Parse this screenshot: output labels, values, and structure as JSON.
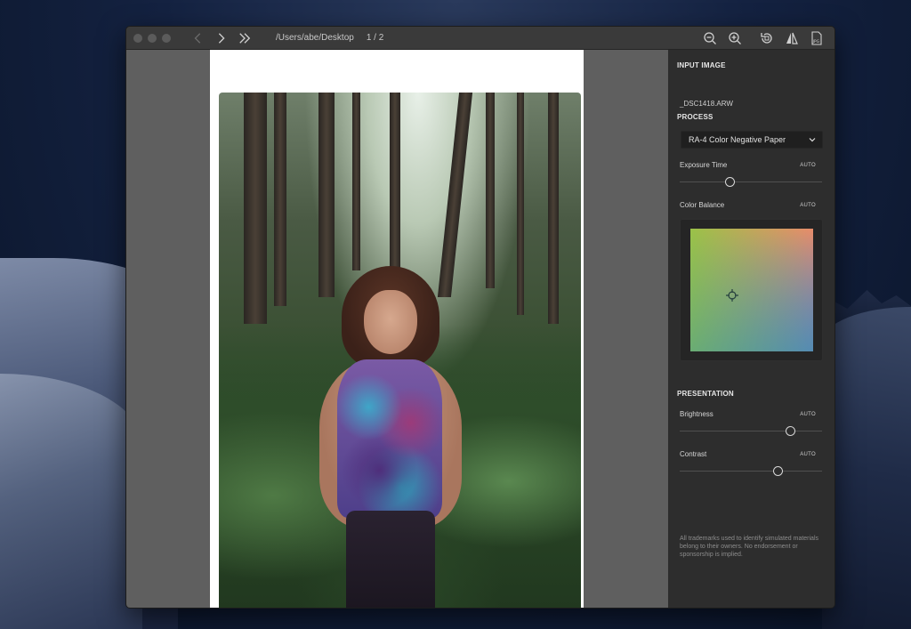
{
  "toolbar": {
    "path": "/Users/abe/Desktop",
    "page_indicator": "1 / 2"
  },
  "sidebar": {
    "input_image": {
      "title": "INPUT IMAGE",
      "filename": "_DSC1418.ARW"
    },
    "process": {
      "title": "PROCESS",
      "paper_type": "RA-4 Color Negative Paper",
      "exposure_time": {
        "label": "Exposure Time",
        "auto_label": "AUTO",
        "value_fraction": 0.35
      },
      "color_balance": {
        "label": "Color Balance",
        "auto_label": "AUTO",
        "point_x": 0.34,
        "point_y": 0.54
      }
    },
    "presentation": {
      "title": "PRESENTATION",
      "brightness": {
        "label": "Brightness",
        "auto_label": "AUTO",
        "value_fraction": 0.78
      },
      "contrast": {
        "label": "Contrast",
        "auto_label": "AUTO",
        "value_fraction": 0.69
      }
    },
    "disclaimer": "All trademarks used to identify simulated materials belong to their owners. No endorsement or sponsorship is implied."
  },
  "icons": {
    "back": "chevron-left-icon",
    "forward": "chevron-right-icon",
    "skip": "double-chevron-right-icon",
    "zoom_out": "zoom-out-icon",
    "zoom_in": "zoom-in-icon",
    "rotate": "rotate-icon",
    "flip": "flip-icon",
    "export": "jpg-export-icon"
  }
}
